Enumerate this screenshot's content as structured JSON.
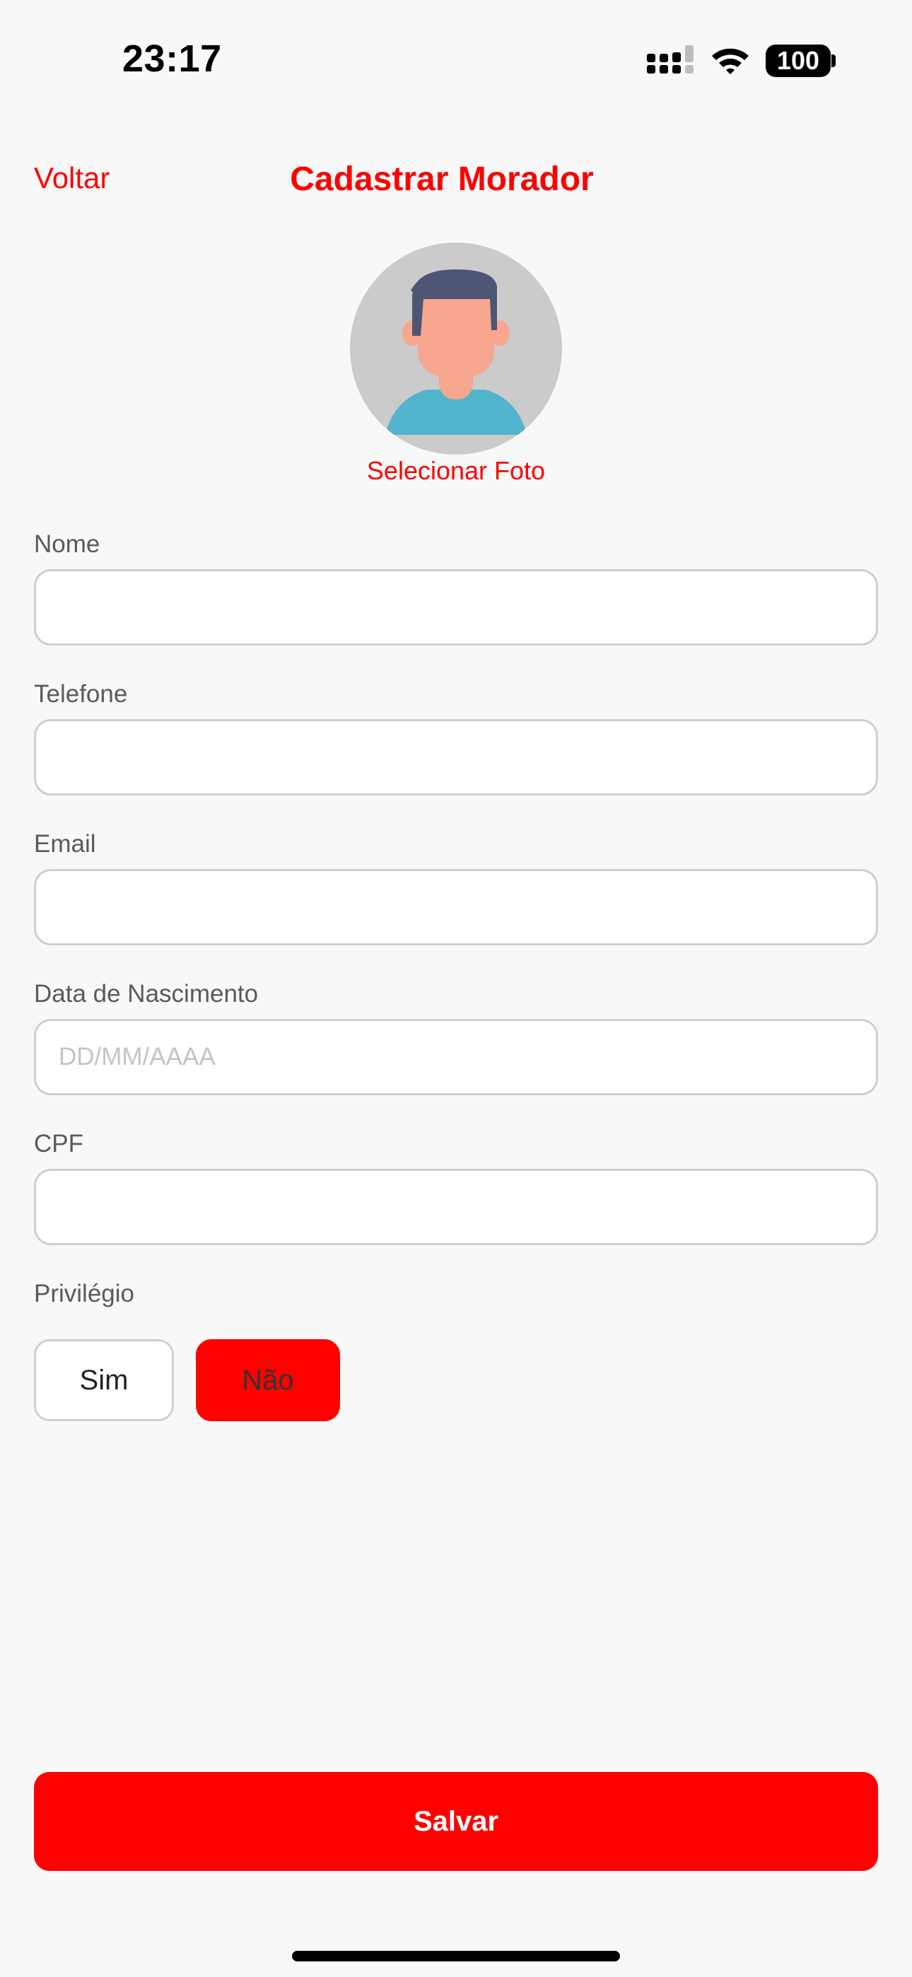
{
  "status_bar": {
    "time": "23:17",
    "battery": "100",
    "icons": [
      "signal-icon",
      "wifi-icon",
      "battery-icon"
    ]
  },
  "header": {
    "back_label": "Voltar",
    "title": "Cadastrar Morador"
  },
  "avatar": {
    "icon": "user-avatar-icon",
    "select_photo_label": "Selecionar Foto"
  },
  "form": {
    "nome": {
      "label": "Nome",
      "value": "",
      "placeholder": ""
    },
    "telefone": {
      "label": "Telefone",
      "value": "",
      "placeholder": ""
    },
    "email": {
      "label": "Email",
      "value": "",
      "placeholder": ""
    },
    "nascimento": {
      "label": "Data de Nascimento",
      "value": "",
      "placeholder": "DD/MM/AAAA"
    },
    "cpf": {
      "label": "CPF",
      "value": "",
      "placeholder": ""
    },
    "privilegio": {
      "label": "Privilégio",
      "options": [
        "Sim",
        "Não"
      ],
      "selected": "Não"
    }
  },
  "save_label": "Salvar",
  "colors": {
    "accent": "#ff0000",
    "background": "#f8f8f8",
    "input_border": "#cfcfcf",
    "label": "#5a5a5a"
  }
}
